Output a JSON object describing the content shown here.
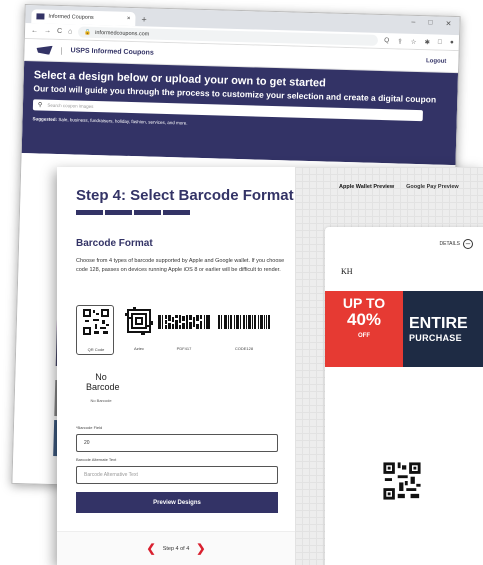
{
  "browser": {
    "tab_title": "Informed Coupons",
    "tab_close": "×",
    "new_tab": "+",
    "window_controls": [
      "–",
      "□",
      "✕"
    ],
    "nav_icons": [
      "←",
      "→",
      "C",
      "⌂"
    ],
    "url": "informedcoupons.com",
    "toolbar_icons": [
      "Q",
      "⇪",
      "☆",
      "✱",
      "□",
      "●",
      "⋮"
    ]
  },
  "site": {
    "title": "USPS Informed Coupons",
    "logout": "Logout",
    "hero_heading": "Select a design below or upload your own to get started",
    "hero_subheading": "Our tool will guide you through the process to customize your selection and create a digital coupon",
    "search_placeholder": "Search coupon images",
    "suggested_label": "Suggested:",
    "suggested_items": "Sale, business, fundraisers, holiday, fashion, services, and more."
  },
  "step": {
    "title": "Step 4: Select Barcode Format",
    "section_title": "Barcode Format",
    "description": "Choose from 4 types of barcode supported by Apple and Google wallet. If you choose code 128, passes on devices running Apple iOS 8 or earlier will be difficult to render.",
    "barcodes": [
      {
        "label": "QR Code",
        "selected": true
      },
      {
        "label": "Aztec",
        "selected": false
      },
      {
        "label": "PDF417",
        "selected": false
      },
      {
        "label": "CODE128",
        "selected": false
      }
    ],
    "no_barcode_big": "No Barcode",
    "no_barcode_small": "No Barcode",
    "barcode_field_label": "*Barcode Field",
    "barcode_field_value": "20",
    "alt_text_label": "Barcode Alternate Text",
    "alt_text_placeholder": "Barcode Alternative Text",
    "preview_button": "Preview Designs",
    "nav_text": "Step 4 of 4",
    "nav_prev": "❮",
    "nav_next": "❯"
  },
  "preview": {
    "tab_apple": "Apple Wallet Preview",
    "tab_google": "Google Pay Preview",
    "details_label": "DETAILS",
    "details_icon": "–",
    "org_initials": "KH",
    "offer_up_to": "UP TO",
    "offer_percent": "40%",
    "offer_off": "OFF",
    "offer_line1": "ENTIRE",
    "offer_line2": "PURCHASE"
  },
  "colors": {
    "brand_navy": "#333366",
    "coupon_red": "#e63a33",
    "coupon_navy": "#1e2b44",
    "nav_arrow_red": "#d9202f"
  }
}
